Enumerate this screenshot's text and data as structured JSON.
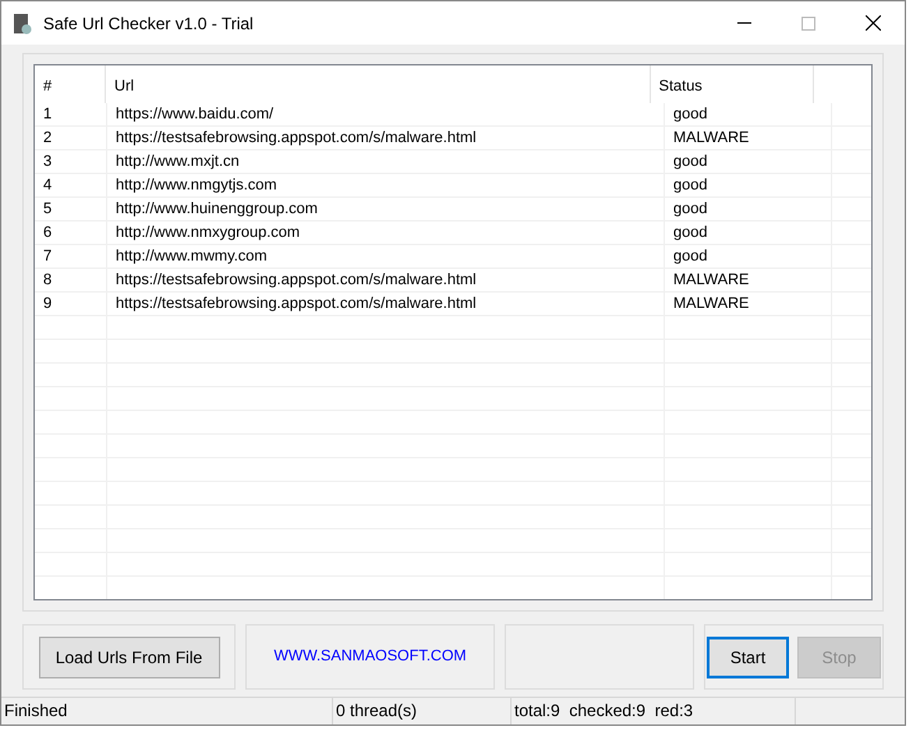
{
  "window": {
    "title": "Safe Url Checker v1.0 - Trial"
  },
  "table": {
    "columns": [
      "#",
      "Url",
      "Status"
    ],
    "rows": [
      {
        "n": "1",
        "url": "https://www.baidu.com/",
        "status": "good"
      },
      {
        "n": "2",
        "url": "https://testsafebrowsing.appspot.com/s/malware.html",
        "status": "MALWARE"
      },
      {
        "n": "3",
        "url": "http://www.mxjt.cn",
        "status": "good"
      },
      {
        "n": "4",
        "url": "http://www.nmgytjs.com",
        "status": "good"
      },
      {
        "n": "5",
        "url": "http://www.huinenggroup.com",
        "status": "good"
      },
      {
        "n": "6",
        "url": "http://www.nmxygroup.com",
        "status": "good"
      },
      {
        "n": "7",
        "url": "http://www.mwmy.com",
        "status": "good"
      },
      {
        "n": "8",
        "url": "https://testsafebrowsing.appspot.com/s/malware.html",
        "status": "MALWARE"
      },
      {
        "n": "9",
        "url": "https://testsafebrowsing.appspot.com/s/malware.html",
        "status": "MALWARE"
      }
    ]
  },
  "load_button": {
    "label": "Load Urls From File"
  },
  "link": "WWW.SANMAOSOFT.COM",
  "start_button": {
    "label": "Start",
    "disabled": false,
    "focused": true
  },
  "stop_button": {
    "label": "Stop",
    "disabled": true,
    "focused": false
  },
  "status_bar": [
    "Finished",
    "0 thread(s)",
    "total:9  checked:9  red:3"
  ]
}
